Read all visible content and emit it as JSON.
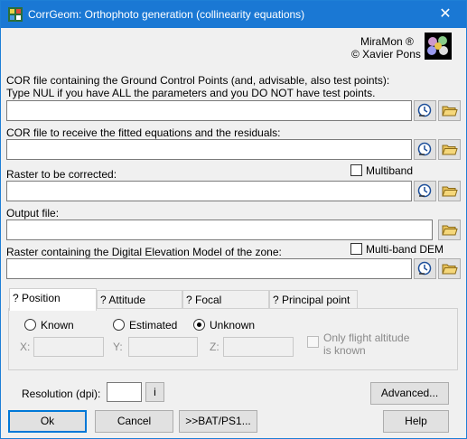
{
  "window": {
    "title": "CorrGeom: Orthophoto generation (collinearity equations)",
    "close_glyph": "✕"
  },
  "brand": {
    "line1": "MiraMon ®",
    "line2": "© Xavier Pons"
  },
  "gcp": {
    "label_line1": "COR file containing the Ground Control Points (and, advisable, also test points):",
    "label_line2": "Type NUL if you have ALL the parameters and you DO NOT have test points.",
    "value": ""
  },
  "fitted": {
    "label": "COR file to receive the fitted equations and the residuals:",
    "value": ""
  },
  "raster": {
    "label": "Raster to be corrected:",
    "value": "",
    "multiband_label": "Multiband"
  },
  "output": {
    "label": "Output file:",
    "value": ""
  },
  "dem": {
    "label": "Raster containing the Digital Elevation Model of the zone:",
    "value": "",
    "multiband_label": "Multi-band DEM"
  },
  "tabs": [
    {
      "label": "? Position"
    },
    {
      "label": "? Attitude"
    },
    {
      "label": "? Focal"
    },
    {
      "label": "? Principal point"
    }
  ],
  "position": {
    "known_label": "Known",
    "estimated_label": "Estimated",
    "unknown_label": "Unknown",
    "x_label": "X:",
    "y_label": "Y:",
    "z_label": "Z:",
    "altitude_label_line1": "Only flight altitude",
    "altitude_label_line2": "is known"
  },
  "resolution": {
    "label": "Resolution (dpi):",
    "value": "",
    "info_label": "i"
  },
  "buttons": {
    "advanced": "Advanced...",
    "ok": "Ok",
    "cancel": "Cancel",
    "bat": ">>BAT/PS1...",
    "help": "Help"
  }
}
